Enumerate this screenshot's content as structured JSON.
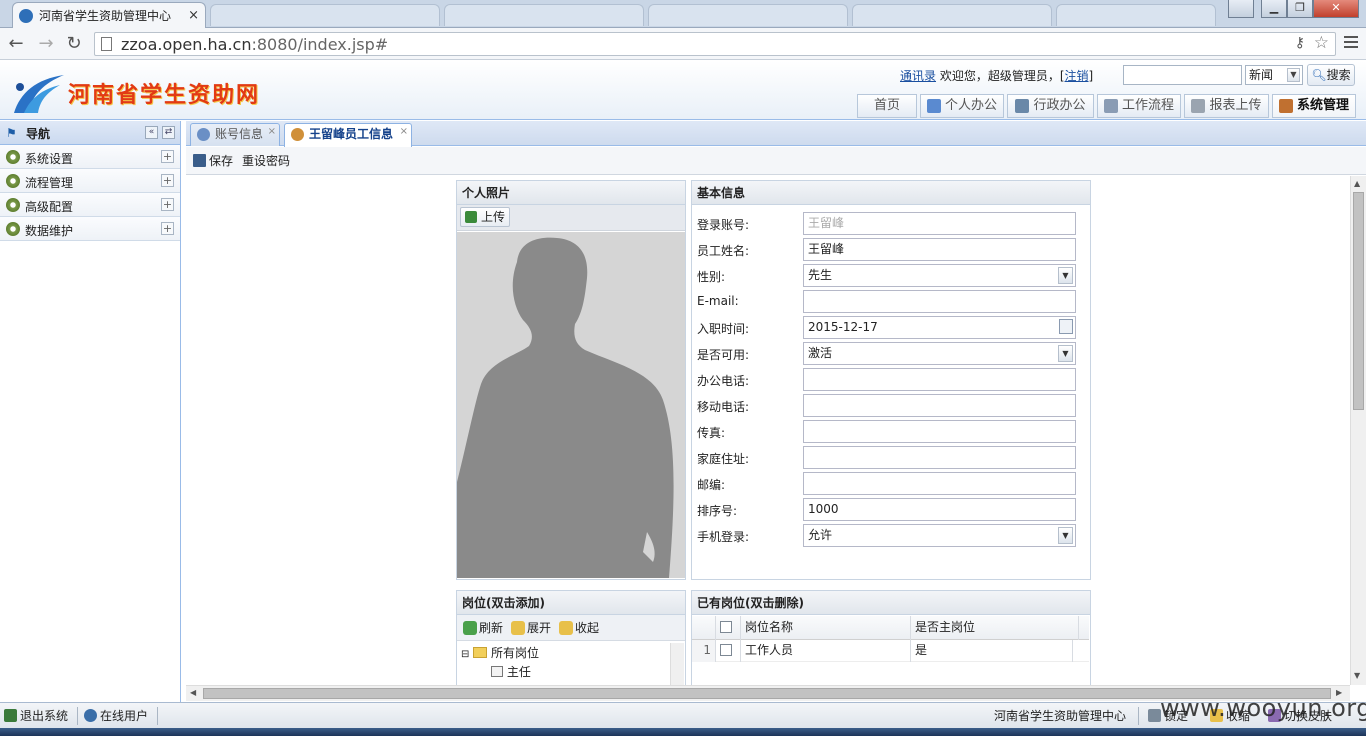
{
  "browser": {
    "active_tab_title": "河南省学生资助管理中心",
    "tab_close": "×",
    "url_host": "zzoa.open.ha.cn",
    "url_rest": ":8080/index.jsp#",
    "window_buttons": [
      "▁",
      "❐",
      "✕"
    ]
  },
  "header": {
    "logo_text": "河南省学生资助网",
    "contacts_link": "通讯录",
    "welcome_text": " 欢迎您，超级管理员，[",
    "logout_link": "注销",
    "welcome_end": "]",
    "search_select": "新闻",
    "search_button": "搜索",
    "nav": [
      "首页",
      "个人办公",
      "行政办公",
      "工作流程",
      "报表上传",
      "系统管理"
    ],
    "active_nav": "系统管理"
  },
  "sidebar": {
    "title": "导航",
    "items": [
      {
        "label": "系统设置"
      },
      {
        "label": "流程管理"
      },
      {
        "label": "高级配置"
      },
      {
        "label": "数据维护"
      }
    ]
  },
  "tabs": [
    {
      "label": "账号信息"
    },
    {
      "label": "王留峰员工信息"
    }
  ],
  "toolbar": {
    "save": "保存",
    "reset_password": "重设密码"
  },
  "photo_panel": {
    "title": "个人照片",
    "upload": "上传"
  },
  "basic_info": {
    "title": "基本信息",
    "fields": [
      {
        "label": "登录账号:",
        "value": "王留峰"
      },
      {
        "label": "员工姓名:",
        "value": "王留峰"
      },
      {
        "label": "性别:",
        "value": "先生"
      },
      {
        "label": "E-mail:",
        "value": ""
      },
      {
        "label": "入职时间:",
        "value": "2015-12-17"
      },
      {
        "label": "是否可用:",
        "value": "激活"
      },
      {
        "label": "办公电话:",
        "value": ""
      },
      {
        "label": "移动电话:",
        "value": ""
      },
      {
        "label": "传真:",
        "value": ""
      },
      {
        "label": "家庭住址:",
        "value": ""
      },
      {
        "label": "邮编:",
        "value": ""
      },
      {
        "label": "排序号:",
        "value": "1000"
      },
      {
        "label": "手机登录:",
        "value": "允许"
      }
    ]
  },
  "positions_panel": {
    "title": "岗位(双击添加)",
    "refresh": "刷新",
    "expand": "展开",
    "collapse": "收起",
    "tree": [
      {
        "label": "所有岗位"
      },
      {
        "label": "主任"
      }
    ]
  },
  "assigned_panel": {
    "title": "已有岗位(双击删除)",
    "columns": [
      "岗位名称",
      "是否主岗位"
    ],
    "rows": [
      {
        "num": "1",
        "name": "工作人员",
        "primary": "是"
      }
    ]
  },
  "statusbar": {
    "exit": "退出系统",
    "online": "在线用户",
    "center": "河南省学生资助管理中心",
    "lock": "锁定",
    "collapse": "收缩",
    "switch_skin": "切换皮肤"
  },
  "watermark": "www.wooyun.org",
  "colors": {
    "accent": "#15428b",
    "border": "#99bbe8",
    "logo": "#e23a14"
  }
}
